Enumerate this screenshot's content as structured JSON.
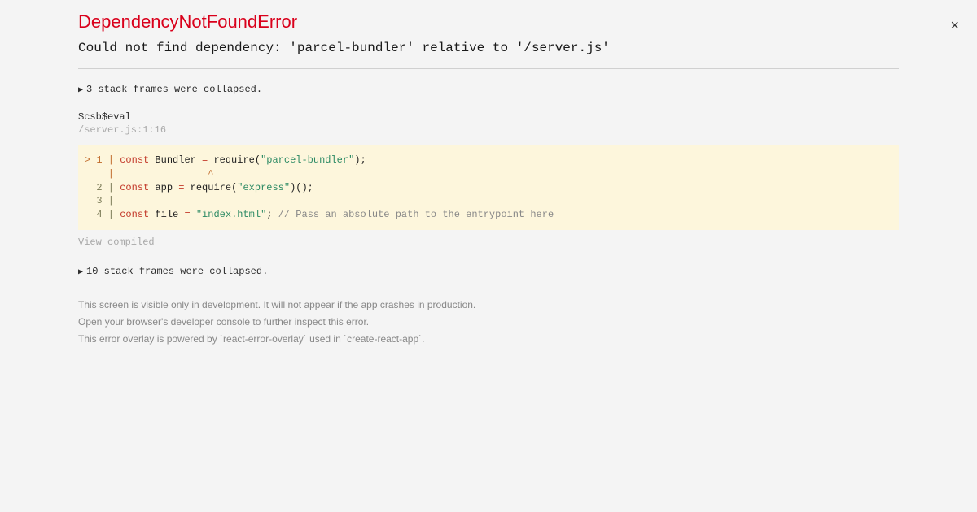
{
  "close_label": "×",
  "error": {
    "title": "DependencyNotFoundError",
    "message": "Could not find dependency: 'parcel-bundler' relative to '/server.js'"
  },
  "collapsed_top": "3 stack frames were collapsed.",
  "frame": {
    "fn": "$csb$eval",
    "loc": "/server.js:1:16"
  },
  "code": {
    "line1_gutter": "> 1 | ",
    "line1_kw_const": "const",
    "line1_sp1": " Bundler ",
    "line1_op_eq": "=",
    "line1_require": " require(",
    "line1_str": "\"parcel-bundler\"",
    "line1_end": ");",
    "line2": "    |                ^",
    "line3_gutter": "  2 | ",
    "line3_kw_const": "const",
    "line3_sp1": " app ",
    "line3_op_eq": "=",
    "line3_require": " require(",
    "line3_str": "\"express\"",
    "line3_end": ")();",
    "line4": "  3 | ",
    "line5_gutter": "  4 | ",
    "line5_kw_const": "const",
    "line5_sp1": " file ",
    "line5_op_eq": "=",
    "line5_sp2": " ",
    "line5_str": "\"index.html\"",
    "line5_semi": "; ",
    "line5_comment": "// Pass an absolute path to the entrypoint here"
  },
  "view_compiled": "View compiled",
  "collapsed_bottom": "10 stack frames were collapsed.",
  "footer": {
    "l1": "This screen is visible only in development. It will not appear if the app crashes in production.",
    "l2": "Open your browser's developer console to further inspect this error.",
    "l3": "This error overlay is powered by `react-error-overlay` used in `create-react-app`."
  }
}
